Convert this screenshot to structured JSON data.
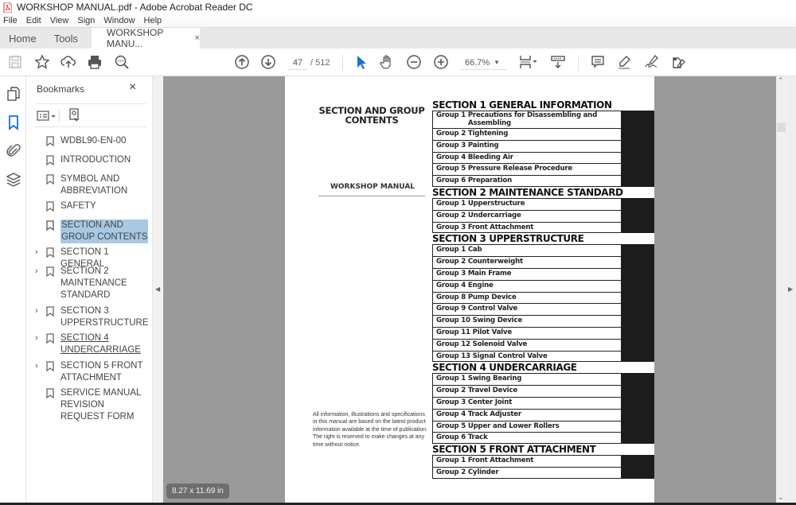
{
  "window": {
    "title": "WORKSHOP MANUAL.pdf - Adobe Acrobat Reader DC",
    "menu": [
      "File",
      "Edit",
      "View",
      "Sign",
      "Window",
      "Help"
    ]
  },
  "tabs": {
    "home": "Home",
    "tools": "Tools",
    "document": "WORKSHOP MANU...",
    "close": "×"
  },
  "toolbar": {
    "page_current": "47",
    "page_total": "/ 512",
    "zoom": "66.7%",
    "icons": [
      "save-icon",
      "bookmark-star-icon",
      "upload-cloud-icon",
      "print-icon",
      "search-zoom-icon",
      "prev-page-icon",
      "next-page-icon",
      "select-cursor-icon",
      "hand-tool-icon",
      "zoom-out-icon",
      "zoom-in-icon",
      "zoom-dropdown-icon",
      "page-fit-icon",
      "scroll-mode-icon",
      "comment-icon",
      "highlight-icon",
      "sign-icon",
      "edit-pdf-icon"
    ]
  },
  "left_rail": {
    "icons": [
      "page-thumbnails-icon",
      "bookmarks-icon",
      "attachments-icon",
      "layers-icon"
    ]
  },
  "bookmarks": {
    "title": "Bookmarks",
    "close": "×",
    "items": [
      {
        "label": "WDBL90-EN-00",
        "expandable": false,
        "selected": false
      },
      {
        "label": "INTRODUCTION",
        "expandable": false,
        "selected": false
      },
      {
        "label": "SYMBOL AND ABBREVIATION",
        "expandable": false,
        "selected": false
      },
      {
        "label": "SAFETY",
        "expandable": false,
        "selected": false
      },
      {
        "label": "SECTION AND GROUP CONTENTS",
        "expandable": false,
        "selected": true
      },
      {
        "label": "SECTION 1 GENERAL",
        "expandable": true,
        "selected": false
      },
      {
        "label": "SECTION 2 MAINTENANCE STANDARD",
        "expandable": true,
        "selected": false
      },
      {
        "label": "SECTION 3 UPPERSTRUCTURE",
        "expandable": true,
        "selected": false
      },
      {
        "label": "SECTION 4 UNDERCARRIAGE",
        "expandable": true,
        "selected": false,
        "underlined": true
      },
      {
        "label": "SECTION 5 FRONT ATTACHMENT",
        "expandable": true,
        "selected": false
      },
      {
        "label": "SERVICE MANUAL REVISION REQUEST FORM",
        "expandable": false,
        "selected": false
      }
    ]
  },
  "document": {
    "title": "SECTION AND GROUP CONTENTS",
    "subtitle": "WORKSHOP MANUAL",
    "note": "All information, illustrations and specifications in this manual are based on the latest product information available at the time of publication. The right is reserved to make changes at any time without notice.",
    "sections": [
      {
        "heading": "SECTION 1 GENERAL INFORMATION",
        "groups": [
          "Group 1 Precautions for Disassembling and Assembling",
          "Group 2 Tightening",
          "Group 3 Painting",
          "Group 4 Bleeding Air",
          "Group 5 Pressure Release Procedure",
          "Group 6 Preparation"
        ]
      },
      {
        "heading": "SECTION 2 MAINTENANCE STANDARD",
        "groups": [
          "Group 1 Upperstructure",
          "Group 2 Undercarriage",
          "Group 3 Front Attachment"
        ]
      },
      {
        "heading": "SECTION 3 UPPERSTRUCTURE",
        "groups": [
          "Group 1 Cab",
          "Group 2 Counterweight",
          "Group 3 Main Frame",
          "Group 4 Engine",
          "Group 8 Pump Device",
          "Group 9 Control Valve",
          "Group 10 Swing Device",
          "Group 11 Pilot Valve",
          "Group 12 Solenoid Valve",
          "Group 13 Signal Control Valve"
        ]
      },
      {
        "heading": "SECTION 4 UNDERCARRIAGE",
        "groups": [
          "Group 1 Swing Bearing",
          "Group 2 Travel Device",
          "Group 3 Center Joint",
          "Group 4 Track Adjuster",
          "Group 5 Upper and Lower Rollers",
          "Group 6 Track"
        ]
      },
      {
        "heading": "SECTION 5 FRONT ATTACHMENT",
        "groups": [
          "Group 1 Front Attachment",
          "Group 2 Cylinder"
        ]
      }
    ],
    "page_size": "8.27 x 11.69 in"
  }
}
